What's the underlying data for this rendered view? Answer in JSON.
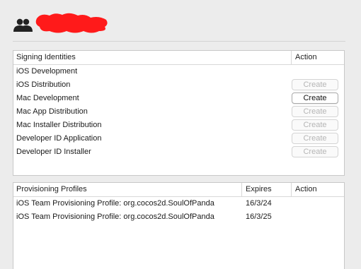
{
  "signing": {
    "header_name": "Signing Identities",
    "header_action": "Action",
    "identities": [
      {
        "name": "iOS Development",
        "has_button": false
      },
      {
        "name": "iOS Distribution",
        "has_button": true,
        "button_label": "Create",
        "enabled": false
      },
      {
        "name": "Mac Development",
        "has_button": true,
        "button_label": "Create",
        "enabled": true
      },
      {
        "name": "Mac App Distribution",
        "has_button": true,
        "button_label": "Create",
        "enabled": false
      },
      {
        "name": "Mac Installer Distribution",
        "has_button": true,
        "button_label": "Create",
        "enabled": false
      },
      {
        "name": "Developer ID Application",
        "has_button": true,
        "button_label": "Create",
        "enabled": false
      },
      {
        "name": "Developer ID Installer",
        "has_button": true,
        "button_label": "Create",
        "enabled": false
      }
    ]
  },
  "profiles": {
    "header_name": "Provisioning Profiles",
    "header_expires": "Expires",
    "header_action": "Action",
    "rows": [
      {
        "name": "iOS Team Provisioning Profile: org.cocos2d.SoulOfPanda",
        "expires": "16/3/24"
      },
      {
        "name": "iOS Team Provisioning Profile: org.cocos2d.SoulOfPanda",
        "expires": "16/3/25"
      }
    ]
  },
  "icons": {
    "avatar": "team-members-icon",
    "redaction_color": "#ff1a1a"
  }
}
